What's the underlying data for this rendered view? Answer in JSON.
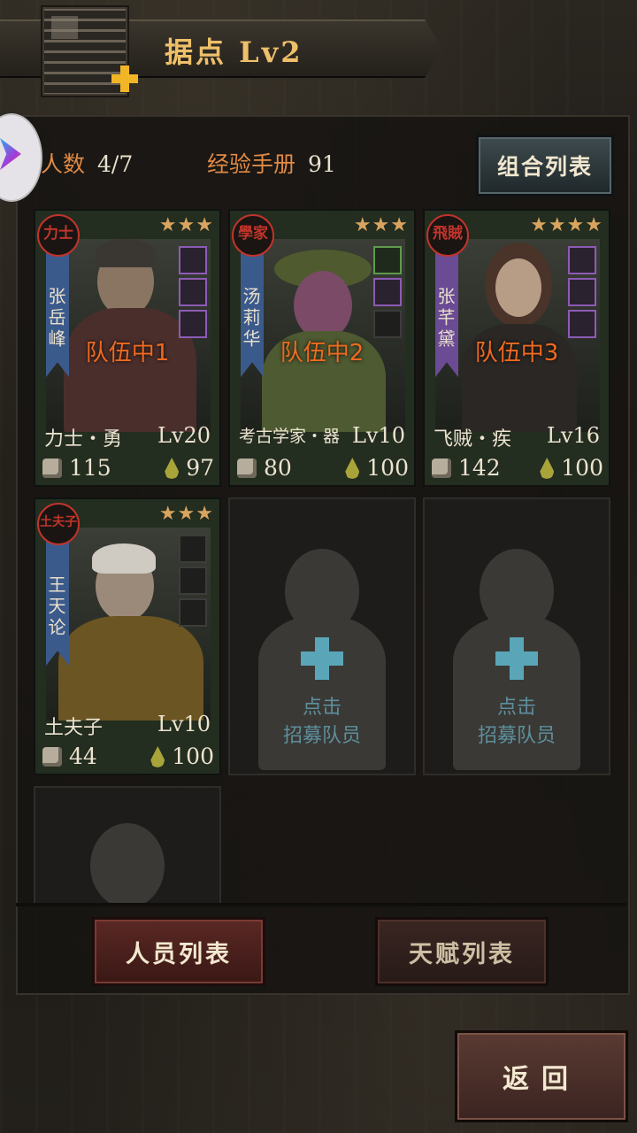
{
  "header": {
    "title": "据点  Lv2"
  },
  "stats": {
    "count_label": "人数",
    "count_value": "4/7",
    "exp_label": "经验手册",
    "exp_value": "91"
  },
  "buttons": {
    "combo": "组合列表",
    "members": "人员列表",
    "talents": "天赋列表",
    "back": "返回"
  },
  "cards": [
    {
      "badge": "力士",
      "name": "张岳峰",
      "stars": "★★★",
      "team": "队伍中1",
      "title": "力士・勇",
      "level": "Lv20",
      "power": "115",
      "stamina": "97",
      "strip": "blue"
    },
    {
      "badge": "學家",
      "name": "汤莉华",
      "stars": "★★★",
      "team": "队伍中2",
      "title": "考古学家・器",
      "level": "Lv10",
      "power": "80",
      "stamina": "100",
      "strip": "blue"
    },
    {
      "badge": "飛賊",
      "name": "张芊黛",
      "stars": "★★★★",
      "team": "队伍中3",
      "title": "飞贼・疾",
      "level": "Lv16",
      "power": "142",
      "stamina": "100",
      "strip": "purple"
    },
    {
      "badge": "土夫子",
      "name": "王天论",
      "stars": "★★★",
      "team": "",
      "title": "土夫子",
      "level": "Lv10",
      "power": "44",
      "stamina": "100",
      "strip": "blue"
    }
  ],
  "recruit": {
    "line1": "点击",
    "line2": "招募队员"
  },
  "colors": {
    "accent": "#efc06a",
    "team_tag": "#ef6a1f",
    "label": "#e08a45"
  }
}
